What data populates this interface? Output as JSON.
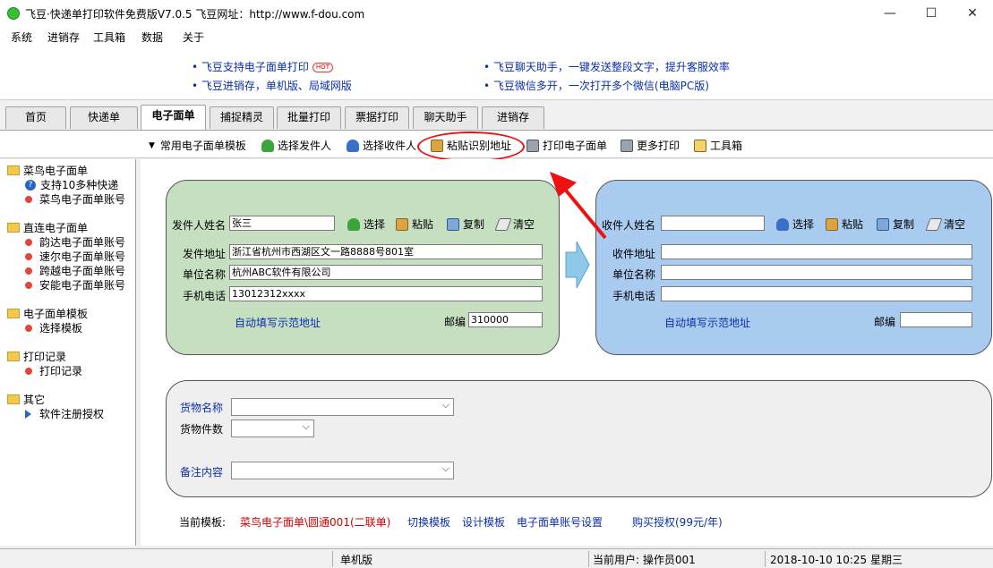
{
  "window": {
    "title": "飞豆·快递单打印软件免费版V7.0.5    飞豆网址：http://www.f-dou.com",
    "minimize": "—",
    "maximize": "☐",
    "close": "✕"
  },
  "menu": [
    "系统",
    "进销存",
    "工具箱",
    "数据",
    "关于"
  ],
  "ads": {
    "left": [
      "飞豆支持电子面单打印",
      "飞豆进销存，单机版、局域网版"
    ],
    "hot_badge": "HOT",
    "right": [
      "飞豆聊天助手，一键发送整段文字，提升客服效率",
      "飞豆微信多开，一次打开多个微信(电脑PC版)"
    ]
  },
  "tabs": [
    "首页",
    "快递单",
    "电子面单",
    "捕捉精灵",
    "批量打印",
    "票据打印",
    "聊天助手",
    "进销存"
  ],
  "toolbar": {
    "template": "常用电子面单模板",
    "select_sender": "选择发件人",
    "select_receiver": "选择收件人",
    "paste_recognize": "粘贴识别地址",
    "print_eorder": "打印电子面单",
    "more_print": "更多打印",
    "toolbox": "工具箱"
  },
  "sidebar": {
    "groups": [
      {
        "title": "菜鸟电子面单",
        "items": [
          "支持10多种快递",
          "菜鸟电子面单账号"
        ]
      },
      {
        "title": "直连电子面单",
        "items": [
          "韵达电子面单账号",
          "速尔电子面单账号",
          "跨越电子面单账号",
          "安能电子面单账号"
        ]
      },
      {
        "title": "电子面单模板",
        "items": [
          "选择模板"
        ]
      },
      {
        "title": "打印记录",
        "items": [
          "打印记录"
        ]
      },
      {
        "title": "其它",
        "items": [
          "软件注册授权"
        ]
      }
    ]
  },
  "sender": {
    "name_label": "发件人姓名",
    "name_value": "张三",
    "select": "选择",
    "paste": "粘贴",
    "copy": "复制",
    "clear": "清空",
    "address_label": "发件地址",
    "address_value": "浙江省杭州市西湖区文一路8888号801室",
    "company_label": "单位名称",
    "company_value": "杭州ABC软件有限公司",
    "phone_label": "手机电话",
    "phone_value": "13012312xxxx",
    "auto_fill": "自动填写示范地址",
    "zip_label": "邮编",
    "zip_value": "310000"
  },
  "receiver": {
    "name_label": "收件人姓名",
    "name_value": "",
    "select": "选择",
    "paste": "粘贴",
    "copy": "复制",
    "clear": "清空",
    "address_label": "收件地址",
    "company_label": "单位名称",
    "phone_label": "手机电话",
    "auto_fill": "自动填写示范地址",
    "zip_label": "邮编"
  },
  "goods": {
    "name_label": "货物名称",
    "count_label": "货物件数",
    "remark_label": "备注内容"
  },
  "bottom": {
    "current_template_label": "当前模板:",
    "current_template_value": "菜鸟电子面单\\圆通001(二联单)",
    "switch_template": "切换模板",
    "design_template": "设计模板",
    "account_settings": "电子面单账号设置",
    "buy_license": "购买授权(99元/年)"
  },
  "status": {
    "mode": "单机版",
    "user": "当前用户: 操作员001",
    "datetime": "2018-10-10 10:25 星期三"
  },
  "colors": {
    "sender_panel": "#c6dfc1",
    "receiver_panel": "#a9cbf0",
    "annotation": "#ee1111",
    "link": "#0b2fa8"
  }
}
